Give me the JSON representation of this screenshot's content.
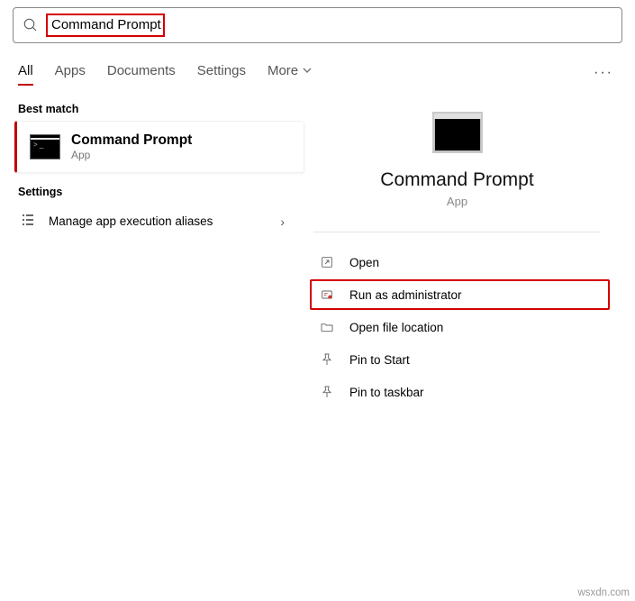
{
  "search": {
    "value": "Command Prompt"
  },
  "tabs": {
    "all": "All",
    "apps": "Apps",
    "documents": "Documents",
    "settings": "Settings",
    "more": "More"
  },
  "left": {
    "best_match_header": "Best match",
    "result": {
      "title": "Command Prompt",
      "subtitle": "App"
    },
    "settings_header": "Settings",
    "settings_item": "Manage app execution aliases"
  },
  "right": {
    "title": "Command Prompt",
    "subtitle": "App",
    "actions": {
      "open": "Open",
      "run_admin": "Run as administrator",
      "file_loc": "Open file location",
      "pin_start": "Pin to Start",
      "pin_taskbar": "Pin to taskbar"
    }
  },
  "watermark": "wsxdn.com"
}
